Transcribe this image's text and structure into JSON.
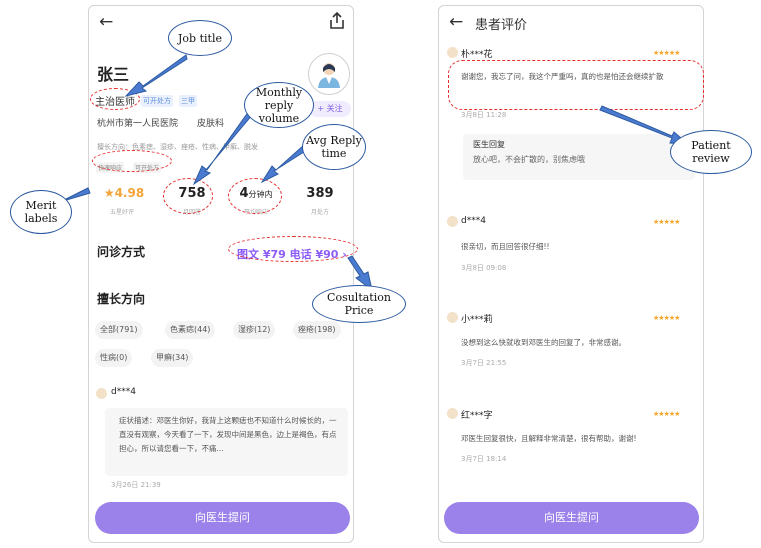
{
  "left_phone": {
    "doctor_name": "张三",
    "job_title": "主治医师",
    "tags": [
      "可开处方",
      "三甲"
    ],
    "follow_label": "+ 关注",
    "hospital": "杭州市第一人民医院",
    "department": "皮肤科",
    "specialty_summary": "擅长方向：色素痣、湿疹、痤疮、性病、甲癣、脱发",
    "merit_labels": [
      "快速响应",
      "可开处方"
    ],
    "stats": [
      {
        "value": "4.98",
        "label": "五星好评"
      },
      {
        "value": "758",
        "label": "月回答"
      },
      {
        "value": "4",
        "unit": "分钟内",
        "label": "平均响应"
      },
      {
        "value": "389",
        "label": "月处方"
      }
    ],
    "consult_title": "问诊方式",
    "price_text": "图文 ¥79  电话 ¥90 ›",
    "expertise_title": "擅长方向",
    "chips": [
      "全部(791)",
      "色素痣(44)",
      "湿疹(12)",
      "痤疮(198)",
      "性病(0)",
      "甲癣(34)"
    ],
    "review": {
      "user": "d***4",
      "content": "症状描述：邓医生你好，我背上这颗痣也不知道什么时候长的，一直没有观察，今天看了一下，发现中间是黑色，边上是褐色，有点担心，所以请您看一下，不痛...",
      "date": "3月26日 21:39"
    },
    "ask_button": "向医生提问"
  },
  "right_phone": {
    "title": "患者评价",
    "reviews": [
      {
        "user": "朴***花",
        "content": "谢谢您，我忘了问，我这个严重吗，真的也是怕还会继续扩散",
        "date": "3月8日 11:28",
        "reply_title": "医生回复",
        "reply_text": "放心吧，不会扩散的，别焦虑哦"
      },
      {
        "user": "d***4",
        "content": "很亲切，而且回答很仔细!!",
        "date": "3月8日 09:08"
      },
      {
        "user": "小***莉",
        "content": "没想到这么快就收到邓医生的回复了，非常感谢。",
        "date": "3月7日 21:55"
      },
      {
        "user": "红***字",
        "content": "邓医生回复很快，且解释非常清楚，很有帮助，谢谢!",
        "date": "3月7日 18:14"
      }
    ],
    "ask_button": "向医生提问"
  },
  "annotations": {
    "job_title": "Job title",
    "monthly_reply": "Monthly reply volume",
    "avg_reply": "Avg Reply time",
    "merit_labels": "Merit labels",
    "consult_price": "Cosultation Price",
    "patient_review": "Patient review"
  },
  "colors": {
    "accent": "#9b82ea",
    "price": "#8b5cf6",
    "star": "#f6a52b",
    "annotation_red": "#e62e2e",
    "annotation_blue": "#2c5aa0"
  }
}
